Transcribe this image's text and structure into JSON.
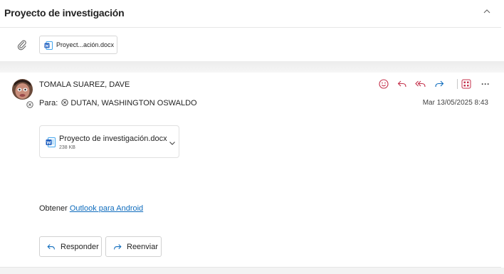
{
  "thread": {
    "subject": "Proyecto de investigación",
    "collapse_icon": "chevron-up-icon"
  },
  "attachments_bar": {
    "icon": "paperclip-icon",
    "chip_label": "Proyect...ación.docx"
  },
  "message": {
    "sender": "TOMALA SUAREZ, DAVE",
    "to_label": "Para:",
    "recipient": "DUTAN, WASHINGTON OSWALDO",
    "date": "Mar 13/05/2025 8:43",
    "actions": [
      "smiley-icon",
      "reply-icon",
      "reply-all-icon",
      "forward-icon",
      "apps-icon",
      "more-icon"
    ],
    "more_label": "···",
    "attachment": {
      "name": "Proyecto de investigación.docx",
      "size": "238 KB"
    },
    "promo": {
      "prefix": "Obtener ",
      "link": "Outlook para Android"
    },
    "reply_label": "Responder",
    "forward_label": "Reenviar"
  },
  "colors": {
    "accent": "#0f6cbd",
    "reaction": "#c4314b",
    "word_blue": "#185abd"
  }
}
